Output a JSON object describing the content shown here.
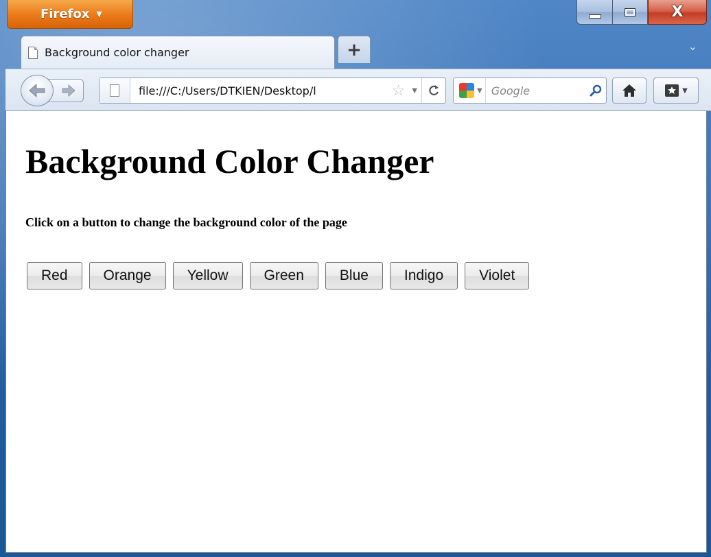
{
  "browser": {
    "menu_button_label": "Firefox",
    "new_tab_label": "+",
    "tab_list_glyph": "⌄",
    "caption": {
      "close_glyph": "X"
    }
  },
  "tab": {
    "title": "Background color changer"
  },
  "toolbar": {
    "url": "file:///C:/Users/DTKIEN/Desktop/l",
    "search_placeholder": "Google",
    "icons": [
      "back-arrow-icon",
      "forward-arrow-icon",
      "page-icon",
      "star-icon",
      "reload-icon",
      "google-icon",
      "search-icon",
      "home-icon",
      "bookmarks-icon"
    ]
  },
  "page": {
    "heading": "Background Color Changer",
    "instruction": "Click on a button to change the background color of the page",
    "buttons": [
      "Red",
      "Orange",
      "Yellow",
      "Green",
      "Blue",
      "Indigo",
      "Violet"
    ]
  },
  "colors": {
    "firefox_button": "#ec7c1b",
    "close_button": "#c33d26",
    "page_background": "#ffffff"
  }
}
